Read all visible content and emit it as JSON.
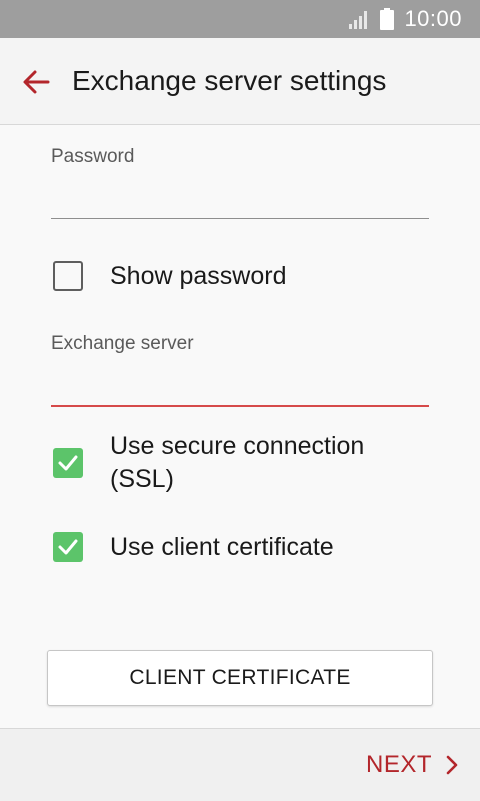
{
  "status_bar": {
    "time": "10:00",
    "icons": [
      "signal-icon",
      "battery-icon"
    ]
  },
  "header": {
    "title": "Exchange server settings",
    "back_icon": "arrow-back-icon"
  },
  "form": {
    "password": {
      "label": "Password",
      "value": ""
    },
    "show_password": {
      "label": "Show password",
      "checked": false
    },
    "exchange_server": {
      "label": "Exchange server",
      "value": "",
      "focused": true
    },
    "ssl": {
      "label_line1": "Use secure connection",
      "label_line2": "(SSL)",
      "checked": true
    },
    "client_cert": {
      "label": "Use client certificate",
      "checked": true
    },
    "client_cert_button": "CLIENT CERTIFICATE"
  },
  "footer": {
    "next_label": "NEXT",
    "next_icon": "chevron-right-icon"
  },
  "colors": {
    "accent": "#b3262b",
    "focus_underline": "#d64a4a",
    "checkbox_checked": "#5cc46a",
    "status_bar": "#9e9e9e"
  }
}
